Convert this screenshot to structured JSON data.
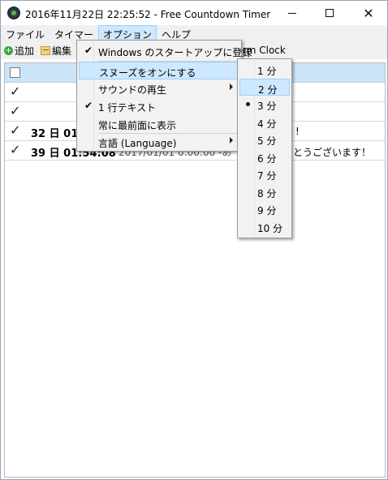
{
  "window": {
    "title": "2016年11月22日 22:25:52 - Free Countdown Timer",
    "icons": {
      "app": "countdown-clock-icon"
    }
  },
  "menubar": {
    "items": [
      "ファイル",
      "タイマー",
      "オプション",
      "ヘルプ"
    ],
    "active": "オプション"
  },
  "toolbar": {
    "add_label": "追加",
    "edit_label": "編集",
    "alarm_clock_partial": "rm Clock"
  },
  "list": {
    "rows": [
      {
        "checked": true,
        "count": "",
        "date": "",
        "tail": ""
      },
      {
        "checked": true,
        "count": "",
        "date": "",
        "tail": ""
      },
      {
        "checked": true,
        "count": "32 日 01",
        "date": "",
        "tail": "!"
      },
      {
        "checked": true,
        "count": "39 日 01:54:08",
        "date": "2017/01/01 0:00:00 -あ",
        "tail": "とうございます！"
      }
    ]
  },
  "options_menu": {
    "items": [
      {
        "label": "Windows のスタートアップに登録",
        "checked": true,
        "submenu": false
      },
      {
        "label": "スヌーズをオンにする",
        "checked": false,
        "submenu": false,
        "highlighted": true
      },
      {
        "label": "サウンドの再生",
        "checked": false,
        "submenu": true
      },
      {
        "label": "1 行テキスト",
        "checked": true,
        "submenu": false
      },
      {
        "label": "常に最前面に表示",
        "checked": false,
        "submenu": false
      },
      {
        "label": "言語 (Language)",
        "checked": false,
        "submenu": true
      }
    ]
  },
  "snooze_submenu": {
    "items": [
      "1 分",
      "2 分",
      "3 分",
      "4 分",
      "5 分",
      "6 分",
      "7 分",
      "8 分",
      "9 分",
      "10 分"
    ],
    "selected": "3 分",
    "highlighted": "2 分"
  }
}
